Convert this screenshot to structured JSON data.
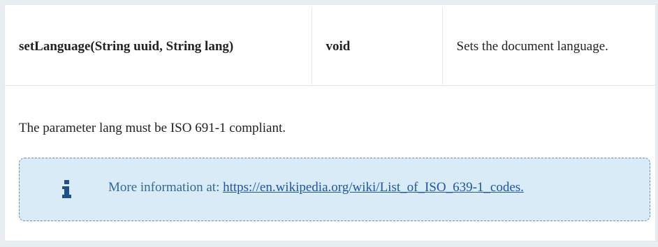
{
  "method_row": {
    "signature": "setLanguage(String uuid, String lang)",
    "return_type": "void",
    "description": "Sets the document language."
  },
  "note": {
    "text": "The parameter lang must be ISO 691-1 compliant."
  },
  "info": {
    "icon": "info-icon",
    "prefix": "More information at:",
    "link_text": "https://en.wikipedia.org/wiki/List_of_ISO_639-1_codes."
  },
  "colors": {
    "info_background": "#d8ebf6",
    "info_border": "#5e93bc",
    "info_text": "#2f6a9a",
    "link": "#1e55a8",
    "icon": "#1e4f8a"
  }
}
